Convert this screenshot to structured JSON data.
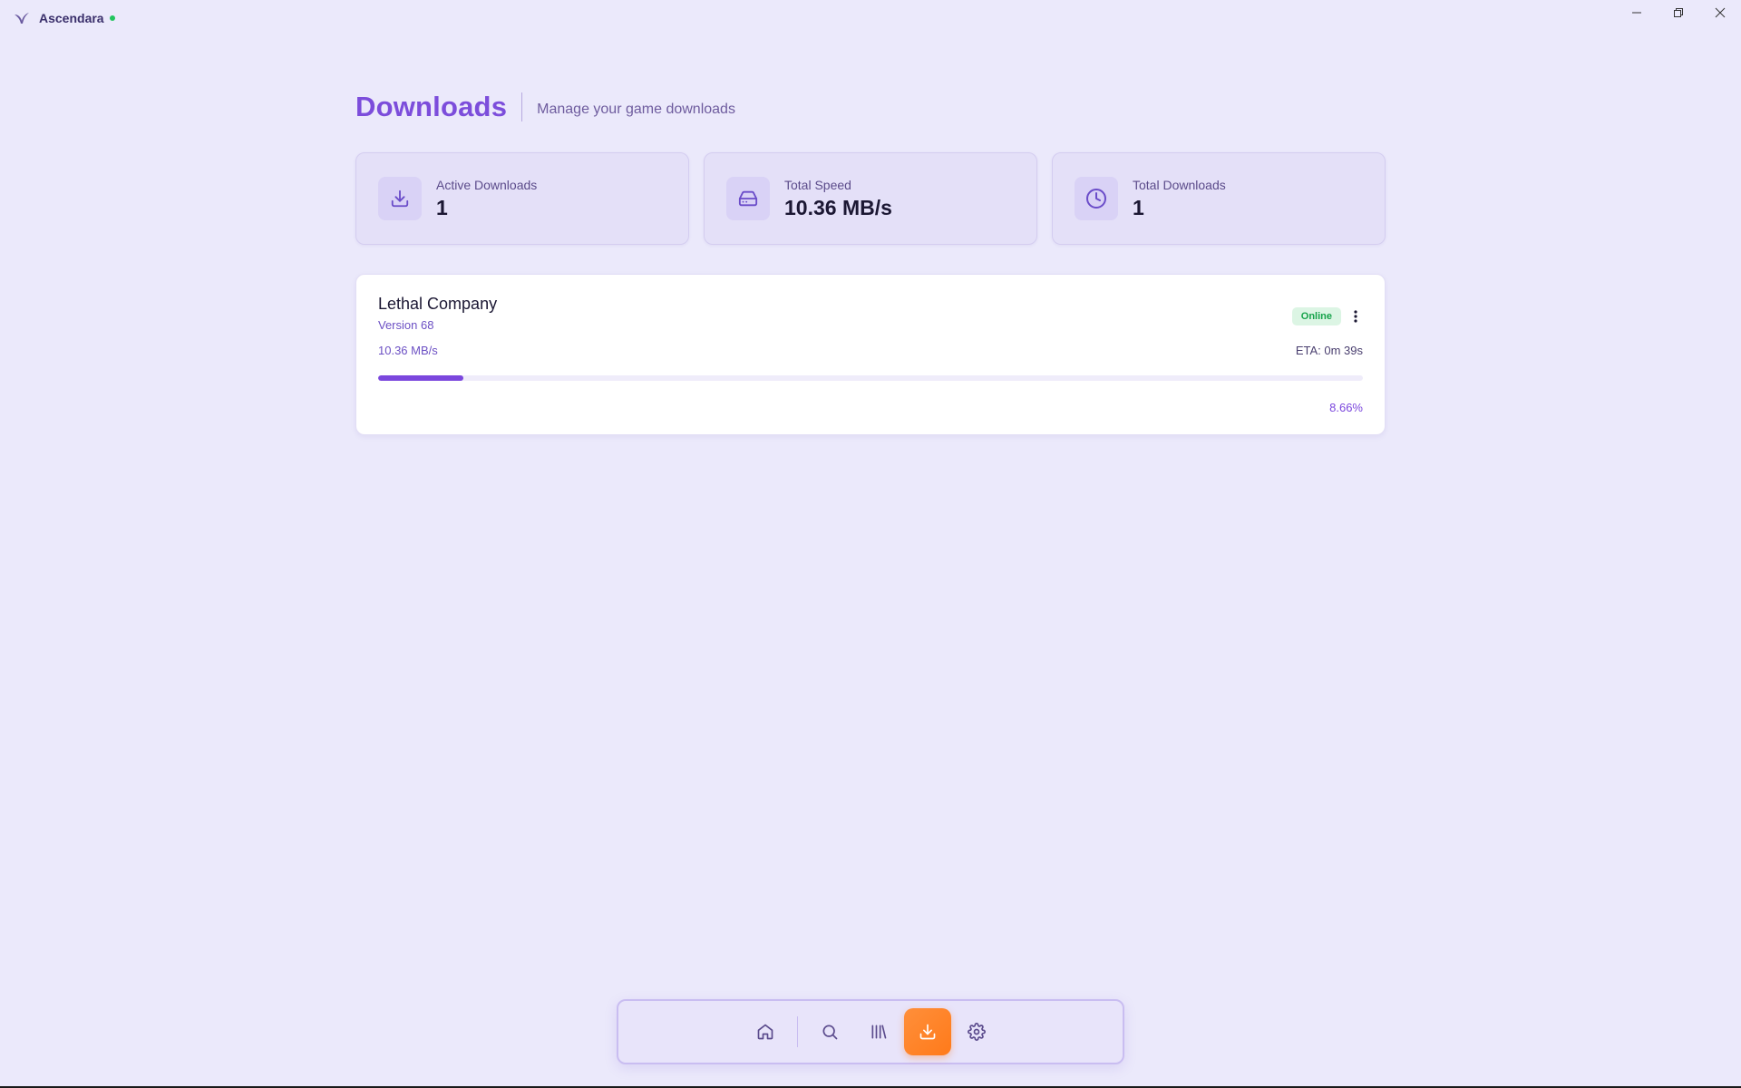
{
  "app": {
    "name": "Ascendara",
    "logo_icon": "ascendara-logo-icon",
    "status_color": "#22c55e"
  },
  "window_controls": [
    {
      "name": "minimize",
      "icon": "minimize-icon"
    },
    {
      "name": "maximize",
      "icon": "restore-icon"
    },
    {
      "name": "close",
      "icon": "close-icon"
    }
  ],
  "header": {
    "title": "Downloads",
    "subtitle": "Manage your game downloads"
  },
  "stats": [
    {
      "label": "Active Downloads",
      "value": "1",
      "icon": "download-icon"
    },
    {
      "label": "Total Speed",
      "value": "10.36 MB/s",
      "icon": "hard-drive-icon"
    },
    {
      "label": "Total Downloads",
      "value": "1",
      "icon": "clock-icon"
    }
  ],
  "download": {
    "name": "Lethal Company",
    "version": "Version 68",
    "status": "Online",
    "speed": "10.36 MB/s",
    "eta": "ETA: 0m 39s",
    "progress_percent": 8.66,
    "progress_label": "8.66%"
  },
  "nav": {
    "items": [
      {
        "name": "home",
        "icon": "home-icon"
      },
      {
        "name": "search",
        "icon": "search-icon"
      },
      {
        "name": "library",
        "icon": "library-icon"
      },
      {
        "name": "downloads",
        "icon": "download-icon",
        "active": true
      },
      {
        "name": "settings",
        "icon": "gear-icon"
      }
    ]
  },
  "colors": {
    "accent": "#7c4ddb",
    "background": "#ebe9fb",
    "active_nav": "#ff8a30",
    "online": "#16a34a"
  }
}
